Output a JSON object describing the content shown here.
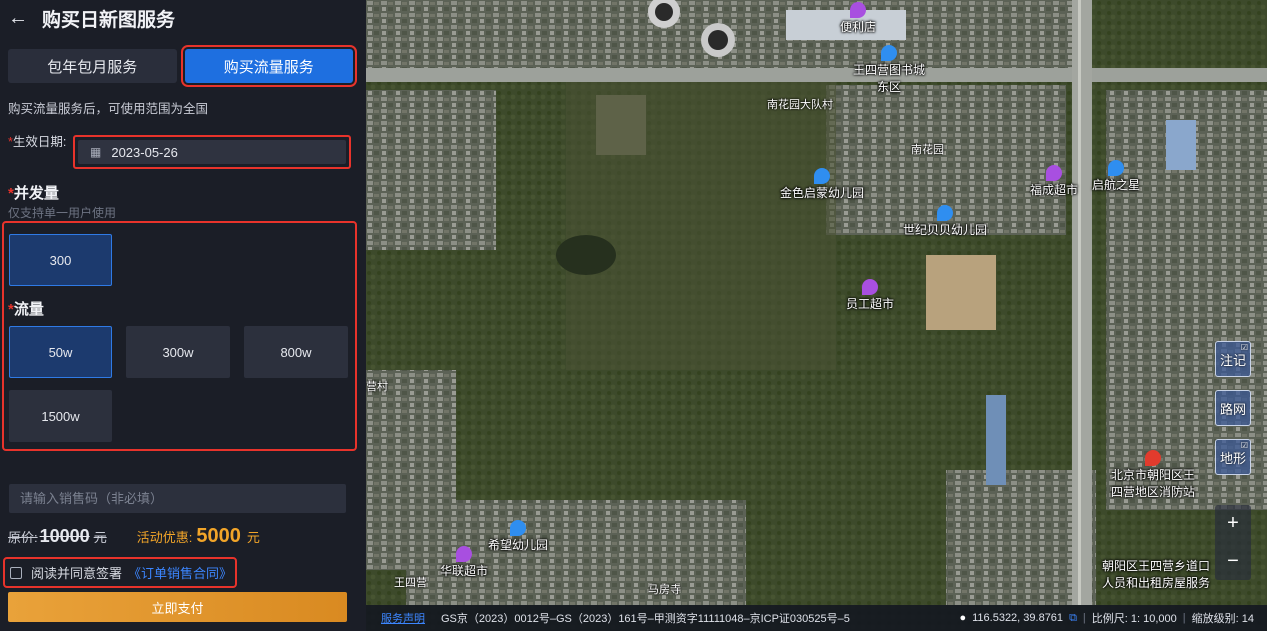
{
  "header": {
    "back_icon": "arrow-left-icon",
    "title": "购买日新图服务"
  },
  "tabs": [
    {
      "label": "包年包月服务",
      "active": false
    },
    {
      "label": "购买流量服务",
      "active": true
    }
  ],
  "note": "购买流量服务后，可使用范围为全国",
  "effective_date": {
    "label": "生效日期:",
    "value": "2023-05-26",
    "icon": "calendar-icon"
  },
  "concurrency": {
    "title": "并发量",
    "subtitle": "仅支持单一用户使用",
    "options": [
      {
        "label": "300",
        "selected": true
      }
    ]
  },
  "flow": {
    "title": "流量",
    "options": [
      {
        "label": "50w",
        "selected": true
      },
      {
        "label": "300w",
        "selected": false
      },
      {
        "label": "800w",
        "selected": false
      },
      {
        "label": "1500w",
        "selected": false
      }
    ]
  },
  "sales_code": {
    "placeholder": "请输入销售码（非必填）",
    "value": ""
  },
  "price": {
    "original_label": "原价:",
    "original_value": "10000",
    "original_unit": "元",
    "promo_label": "活动优惠:",
    "promo_value": "5000",
    "promo_unit": "元"
  },
  "agreement": {
    "checked": false,
    "text": "阅读并同意签署",
    "link": "《订单销售合同》"
  },
  "pay_button": "立即支付",
  "map": {
    "pois": [
      {
        "name": "便利店",
        "icon": "shop-icon"
      },
      {
        "name": "王四营图书城\n东区",
        "icon": "book-icon"
      },
      {
        "name": "南花园大队村",
        "icon": ""
      },
      {
        "name": "南花园",
        "icon": ""
      },
      {
        "name": "金色启蒙幼儿园",
        "icon": "school-icon"
      },
      {
        "name": "福成超市",
        "icon": "shop-icon"
      },
      {
        "name": "启航之星",
        "icon": "school-icon"
      },
      {
        "name": "世纪贝贝幼儿园",
        "icon": "school-icon"
      },
      {
        "name": "员工超市",
        "icon": "shop-icon"
      },
      {
        "name": "北京市朝阳区王\n四营地区消防站",
        "icon": "fire-station-icon"
      },
      {
        "name": "希望幼儿园",
        "icon": "school-icon"
      },
      {
        "name": "华联超市",
        "icon": "shop-icon"
      },
      {
        "name": "王四营",
        "icon": ""
      },
      {
        "name": "马房寺",
        "icon": ""
      },
      {
        "name": "朝阳区王四营乡道口\n人员和出租房屋服务",
        "icon": ""
      },
      {
        "name": "营村",
        "icon": ""
      }
    ],
    "layers": [
      {
        "label": "注记",
        "icon": "label-layer-icon"
      },
      {
        "label": "路网",
        "icon": "road-layer-icon"
      },
      {
        "label": "地形",
        "icon": "terrain-layer-icon"
      }
    ],
    "zoom_in": "+",
    "zoom_out": "−",
    "status": {
      "declaration": "服务声明",
      "license": "GS京（2023）0012号–GS（2023）161号–甲测资字11111048–京ICP证030525号–5",
      "coords": "116.5322, 39.8761",
      "scale": "比例尺: 1: 10,000",
      "zoom_level": "缩放级别: 14"
    }
  }
}
